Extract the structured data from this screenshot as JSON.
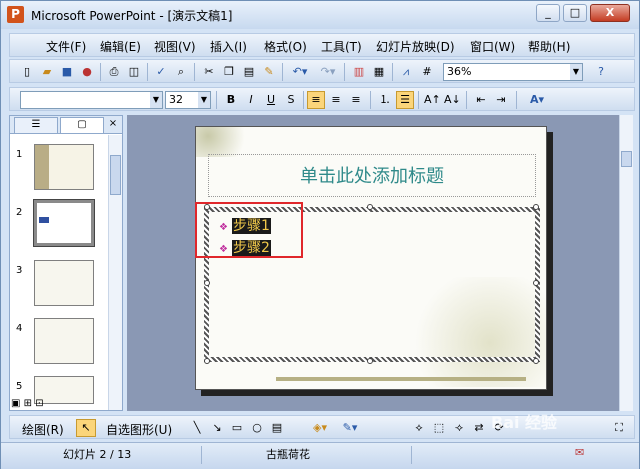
{
  "window": {
    "title": "Microsoft PowerPoint - [演示文稿1]",
    "controls": [
      "_",
      "□",
      "X"
    ]
  },
  "menu": {
    "items": [
      "文件(F)",
      "编辑(E)",
      "视图(V)",
      "插入(I)",
      "格式(O)",
      "工具(T)",
      "幻灯片放映(D)",
      "窗口(W)",
      "帮助(H)"
    ]
  },
  "toolbar": {
    "zoom": "36%",
    "font_size": "32"
  },
  "slides_pane": {
    "numbers": [
      "1",
      "2",
      "3",
      "4",
      "5"
    ],
    "selected": 2
  },
  "slide": {
    "title_placeholder": "单击此处添加标题",
    "bullets": [
      "步骤1",
      "步骤2"
    ]
  },
  "drawing_bar": {
    "draw_label": "绘图(R)",
    "autoshapes_label": "自选图形(U)"
  },
  "status": {
    "slide_info": "幻灯片 2 / 13",
    "design": "古瓶荷花"
  },
  "watermark": "Bai 经验",
  "colors": {
    "accent": "#f0c84a",
    "highlight": "#e0272b",
    "title_text": "#2f8a8a"
  }
}
